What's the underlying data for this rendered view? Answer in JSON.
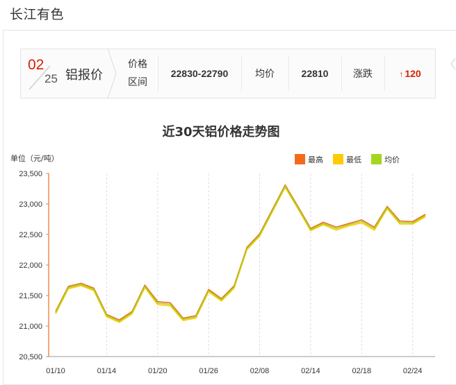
{
  "header": {
    "title": "长江有色"
  },
  "quote": {
    "month": "02",
    "day": "25",
    "product": "铝报价",
    "range_label_1": "价格",
    "range_label_2": "区间",
    "range_value": "22830-22790",
    "avg_label": "均价",
    "avg_value": "22810",
    "change_label": "涨跌",
    "change_value": "120",
    "change_direction": "up",
    "up_color": "#d81e06"
  },
  "chart_data": {
    "type": "line",
    "title": "近30天铝价格走势图",
    "ylabel": "单位（元/吨）",
    "ylim": [
      20500,
      23500
    ],
    "yticks": [
      20500,
      21000,
      21500,
      22000,
      22500,
      23000,
      23500
    ],
    "ytick_labels": [
      "20,500",
      "21,000",
      "21,500",
      "22,000",
      "22,500",
      "23,000",
      "23,500"
    ],
    "xtick_labels": [
      "01/10",
      "01/14",
      "01/20",
      "01/26",
      "02/08",
      "02/14",
      "02/18",
      "02/24"
    ],
    "xtick_index": [
      0,
      4,
      8,
      12,
      16,
      20,
      24,
      28
    ],
    "x": [
      "01/10",
      "01/11",
      "01/12",
      "01/13",
      "01/14",
      "01/15",
      "01/16",
      "01/17",
      "01/20",
      "01/21",
      "01/22",
      "01/23",
      "01/26",
      "01/27",
      "01/28",
      "01/29",
      "02/08",
      "02/09",
      "02/10",
      "02/11",
      "02/14",
      "02/15",
      "02/16",
      "02/17",
      "02/18",
      "02/21",
      "02/22",
      "02/23",
      "02/24",
      "02/25"
    ],
    "grid": "vertical dashed",
    "legend_position": "top-right",
    "series": [
      {
        "name": "最高",
        "color": "#f26b1d",
        "values": [
          21240,
          21650,
          21700,
          21620,
          21190,
          21100,
          21240,
          21670,
          21400,
          21380,
          21130,
          21170,
          21600,
          21450,
          21660,
          22290,
          22510,
          22910,
          23310,
          22960,
          22600,
          22700,
          22620,
          22680,
          22740,
          22620,
          22960,
          22720,
          22710,
          22830
        ]
      },
      {
        "name": "最低",
        "color": "#ffcc00",
        "values": [
          21200,
          21610,
          21660,
          21580,
          21150,
          21060,
          21200,
          21630,
          21350,
          21330,
          21090,
          21130,
          21560,
          21410,
          21620,
          22250,
          22470,
          22870,
          23270,
          22920,
          22560,
          22660,
          22570,
          22640,
          22690,
          22570,
          22920,
          22670,
          22670,
          22790
        ]
      },
      {
        "name": "均价",
        "color": "#a5d61f",
        "values": [
          21220,
          21630,
          21680,
          21600,
          21170,
          21080,
          21220,
          21650,
          21375,
          21355,
          21110,
          21150,
          21580,
          21430,
          21640,
          22270,
          22490,
          22890,
          23290,
          22940,
          22580,
          22680,
          22595,
          22660,
          22715,
          22595,
          22940,
          22695,
          22690,
          22810
        ]
      }
    ]
  }
}
